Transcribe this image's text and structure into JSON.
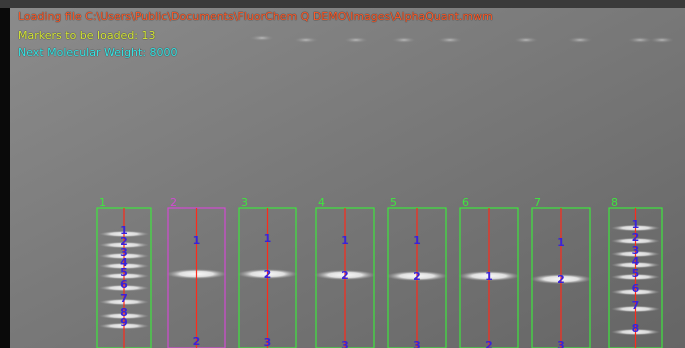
{
  "status": {
    "loading_file": "Loading file C:\\Users\\Public\\Documents\\FluorChem Q DEMO\\Images\\AlphaQuant.mwm",
    "markers_to_load": "Markers to be loaded: 13",
    "next_molecular_weight": "Next Molecular Weight: 8000"
  },
  "colors": {
    "loading": "#ff5a28",
    "markers": "#d8ea3a",
    "next_mw": "#37e6e6",
    "lane_box": "#3ee63e",
    "lane_selected": "#d24ad2",
    "lane_center_line": "#ff2a1a",
    "band_label": "#3b23d8"
  },
  "lanes": [
    {
      "number": "1",
      "selected": false,
      "band_labels": [
        "1",
        "2",
        "3",
        "4",
        "5",
        "6",
        "7",
        "8",
        "9"
      ]
    },
    {
      "number": "2",
      "selected": true,
      "band_labels": [
        "1",
        "2"
      ]
    },
    {
      "number": "3",
      "selected": false,
      "band_labels": [
        "1",
        "2",
        "3"
      ]
    },
    {
      "number": "4",
      "selected": false,
      "band_labels": [
        "1",
        "2",
        "3"
      ]
    },
    {
      "number": "5",
      "selected": false,
      "band_labels": [
        "1",
        "2",
        "3"
      ]
    },
    {
      "number": "6",
      "selected": false,
      "band_labels": [
        "1",
        "2"
      ]
    },
    {
      "number": "7",
      "selected": false,
      "band_labels": [
        "1",
        "2",
        "3"
      ]
    },
    {
      "number": "8",
      "selected": false,
      "band_labels": [
        "1",
        "2",
        "3",
        "4",
        "5",
        "6",
        "7",
        "8"
      ]
    }
  ]
}
